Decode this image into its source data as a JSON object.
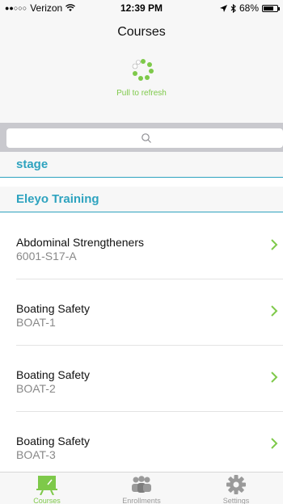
{
  "status_bar": {
    "carrier": "Verizon",
    "time": "12:39 PM",
    "battery": "68%",
    "battery_level": 0.68
  },
  "nav": {
    "title": "Courses"
  },
  "refresh": {
    "text": "Pull to refresh"
  },
  "search": {
    "placeholder": ""
  },
  "sections": [
    {
      "label": "stage"
    },
    {
      "label": "Eleyo Training"
    }
  ],
  "courses": [
    {
      "title": "Abdominal Strengtheners",
      "code": "6001-S17-A"
    },
    {
      "title": "Boating Safety",
      "code": "BOAT-1"
    },
    {
      "title": "Boating Safety",
      "code": "BOAT-2"
    },
    {
      "title": "Boating Safety",
      "code": "BOAT-3"
    }
  ],
  "tabs": [
    {
      "label": "Courses",
      "icon": "chalkboard-icon",
      "active": true
    },
    {
      "label": "Enrollments",
      "icon": "people-icon",
      "active": false
    },
    {
      "label": "Settings",
      "icon": "gear-icon",
      "active": false
    }
  ],
  "colors": {
    "accent": "#2ea3bf",
    "green": "#7ec94a",
    "chevron": "#7ec94a"
  }
}
